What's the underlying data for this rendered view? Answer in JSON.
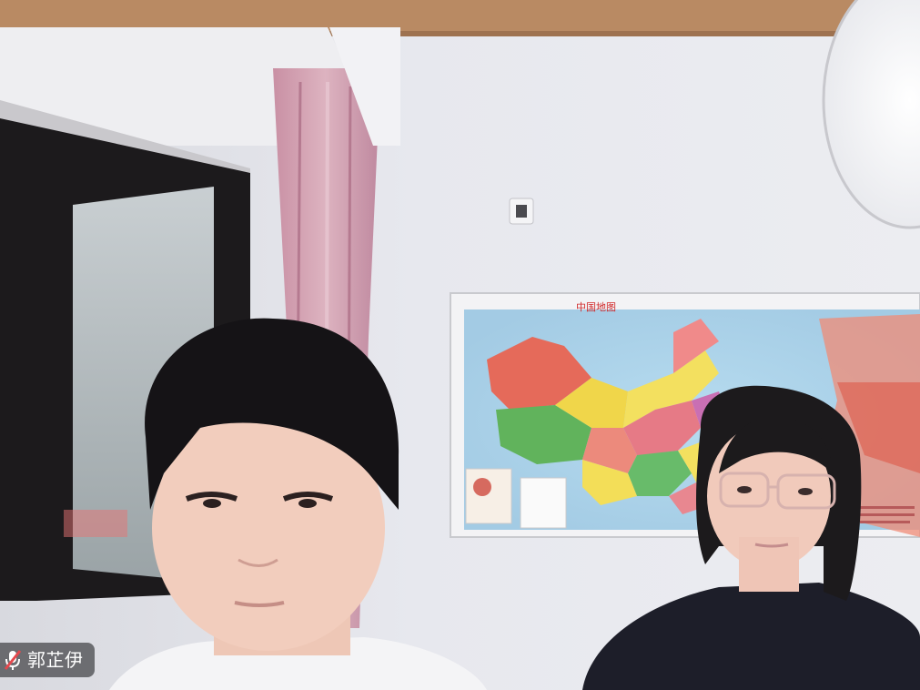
{
  "participant": {
    "name": "郭芷伊",
    "mic_icon": "mic-muted-icon"
  },
  "map": {
    "title": "中国地图"
  },
  "colors": {
    "wall": "#e6e7ec",
    "ceiling_trim": "#b98a63",
    "curtain": "#d7a8b6",
    "name_tag_bg": "#28282c",
    "muted_red": "#e5484d"
  }
}
